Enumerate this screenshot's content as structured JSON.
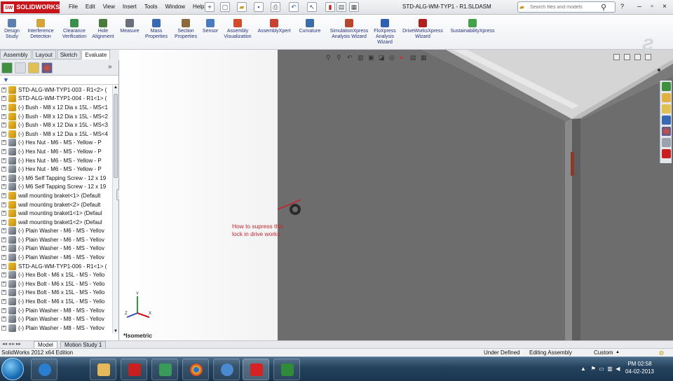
{
  "app": {
    "logo": "SOLIDWORKS",
    "menus": [
      "File",
      "Edit",
      "View",
      "Insert",
      "Tools",
      "Window",
      "Help"
    ],
    "document_title": "STD-ALG-WM-TYP1 - R1.SLDASM",
    "search_placeholder": "Search files and models",
    "help_label": "?"
  },
  "command_manager": {
    "items": [
      {
        "label": "Design Study",
        "color": "#5a7fb0"
      },
      {
        "label": "Interference Detection",
        "color": "#d2a43c"
      },
      {
        "label": "Clearance Verification",
        "color": "#3b8f4d"
      },
      {
        "label": "Hole Alignment",
        "color": "#4c7a3a"
      },
      {
        "label": "Measure",
        "color": "#6a6f7b"
      },
      {
        "label": "Mass Properties",
        "color": "#3a69b4"
      },
      {
        "label": "Section Properties",
        "color": "#8a6a3a"
      },
      {
        "label": "Sensor",
        "color": "#4a7ac0"
      },
      {
        "label": "Assembly Visualization",
        "color": "#d24b2a"
      },
      {
        "label": "AssemblyXpert",
        "color": "#c84232"
      },
      {
        "label": "Curvature",
        "color": "#3b6ea8"
      },
      {
        "label": "SimulationXpress Analysis Wizard",
        "color": "#b5472f"
      },
      {
        "label": "FloXpress Analysis Wizard",
        "color": "#2d5fb2"
      },
      {
        "label": "DriveWorksXpress Wizard",
        "color": "#b2201c"
      },
      {
        "label": "SustainabilityXpress",
        "color": "#44a04a"
      }
    ]
  },
  "cmd_tabs": [
    {
      "label": "Assembly",
      "active": false
    },
    {
      "label": "Layout",
      "active": false
    },
    {
      "label": "Sketch",
      "active": false
    },
    {
      "label": "Evaluate",
      "active": true
    }
  ],
  "feature_tree": {
    "nodes": [
      {
        "label": "STD-ALG-WM-TYP1-003 - R1<2> (",
        "kind": "asm"
      },
      {
        "label": "STD-ALG-WM-TYP1-004 - R1<1> (",
        "kind": "asm"
      },
      {
        "label": "(-) Bush - M8 x 12 Dia x 15L - MS<1",
        "kind": "asm"
      },
      {
        "label": "(-) Bush - M8 x 12 Dia x 15L - MS<2",
        "kind": "asm"
      },
      {
        "label": "(-) Bush - M8 x 12 Dia x 15L - MS<3",
        "kind": "asm"
      },
      {
        "label": "(-) Bush - M8 x 12 Dia x 15L - MS<4",
        "kind": "asm"
      },
      {
        "label": "(-) Hex Nut - M6 - MS - Yellow - P",
        "kind": "part"
      },
      {
        "label": "(-) Hex Nut - M6 - MS - Yellow - P",
        "kind": "part"
      },
      {
        "label": "(-) Hex Nut - M6 - MS - Yellow - P",
        "kind": "part"
      },
      {
        "label": "(-) Hex Nut - M6 - MS - Yellow - P",
        "kind": "part"
      },
      {
        "label": "(-) M6 Self Tapping Screw - 12 x 19",
        "kind": "part"
      },
      {
        "label": "(-) M6 Self Tapping Screw - 12 x 19",
        "kind": "part"
      },
      {
        "label": "wall mounting braket<1> (Default",
        "kind": "asm"
      },
      {
        "label": "wall mounting braket<2> (Default",
        "kind": "asm"
      },
      {
        "label": "wall mounting braket1<1> (Defaul",
        "kind": "asm"
      },
      {
        "label": "wall mounting braket1<2> (Defaul",
        "kind": "asm"
      },
      {
        "label": "(-) Plain Washer - M6 - MS - Yellov",
        "kind": "part"
      },
      {
        "label": "(-) Plain Washer - M6 - MS - Yellov",
        "kind": "part"
      },
      {
        "label": "(-) Plain Washer - M6 - MS - Yellov",
        "kind": "part"
      },
      {
        "label": "(-) Plain Washer - M6 - MS - Yellov",
        "kind": "part"
      },
      {
        "label": "STD-ALG-WM-TYP1-006 - R1<1> (",
        "kind": "asm"
      },
      {
        "label": "(-) Hex Bolt - M6 x 15L - MS - Yello",
        "kind": "part"
      },
      {
        "label": "(-) Hex Bolt - M6 x 15L - MS - Yello",
        "kind": "part"
      },
      {
        "label": "(-) Hex Bolt - M6 x 15L - MS - Yello",
        "kind": "part"
      },
      {
        "label": "(-) Hex Bolt - M6 x 15L - MS - Yello",
        "kind": "part"
      },
      {
        "label": "(-) Plain Washer - M8 - MS - Yellov",
        "kind": "part"
      },
      {
        "label": "(-) Plain Washer - M8 - MS - Yellov",
        "kind": "part"
      },
      {
        "label": "(-) Plain Washer - M8 - MS - Yellov",
        "kind": "part"
      }
    ]
  },
  "bottom_tabs": [
    "Model",
    "Motion Study 1"
  ],
  "viewport": {
    "annotation_line1": "How to supress this",
    "annotation_line2": "lock in drive works",
    "view_name": "*Isometric",
    "triad_x": "X",
    "triad_y": "Y",
    "triad_z": "Z"
  },
  "status": {
    "edition": "SolidWorks 2012 x64 Edition",
    "state": "Under Defined",
    "mode": "Editing Assembly",
    "units": "Custom"
  },
  "taskbar": {
    "time": "PM 02:58",
    "date": "04-02-2013",
    "apps": [
      {
        "name": "ie-icon",
        "color": "#2a7fd0"
      },
      {
        "name": "explorer-icon",
        "color": "#e5b85a"
      },
      {
        "name": "acrobat-icon",
        "color": "#c81f1f"
      },
      {
        "name": "typing-app-icon",
        "color": "#3a9a5a"
      },
      {
        "name": "chrome-icon",
        "color": "#e8b91c"
      },
      {
        "name": "hp-icon",
        "color": "#4a8ad0"
      },
      {
        "name": "solidworks-icon",
        "color": "#d62222"
      },
      {
        "name": "excel-icon",
        "color": "#2f8a3a"
      }
    ]
  }
}
